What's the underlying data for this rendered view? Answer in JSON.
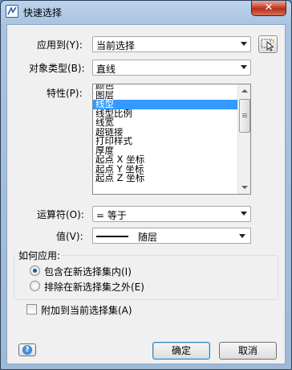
{
  "window": {
    "title": "快速选择",
    "close_glyph": "✕"
  },
  "form": {
    "apply_to": {
      "label": "应用到(Y):",
      "value": "当前选择"
    },
    "object_type": {
      "label": "对象类型(B):",
      "value": "直线"
    },
    "properties": {
      "label": "特性(P):",
      "items": [
        "颜色",
        "图层",
        "线型",
        "线型比例",
        "线宽",
        "超链接",
        "打印样式",
        "厚度",
        "起点 X 坐标",
        "起点 Y 坐标",
        "起点 Z 坐标"
      ],
      "selected_index": 2
    },
    "operator": {
      "label": "运算符(O):",
      "value": "= 等于"
    },
    "value": {
      "label": "值(V):",
      "value": "随层"
    }
  },
  "how_to_apply": {
    "title": "如何应用:",
    "options": [
      {
        "label": "包含在新选择集内(I)",
        "checked": true
      },
      {
        "label": "排除在新选择集之外(E)",
        "checked": false
      }
    ]
  },
  "append": {
    "label": "附加到当前选择集(A)",
    "checked": false
  },
  "buttons": {
    "ok": "确定",
    "cancel": "取消"
  },
  "icons": {
    "app": "app-icon",
    "pick": "select-objects-icon",
    "help": "help-icon"
  }
}
